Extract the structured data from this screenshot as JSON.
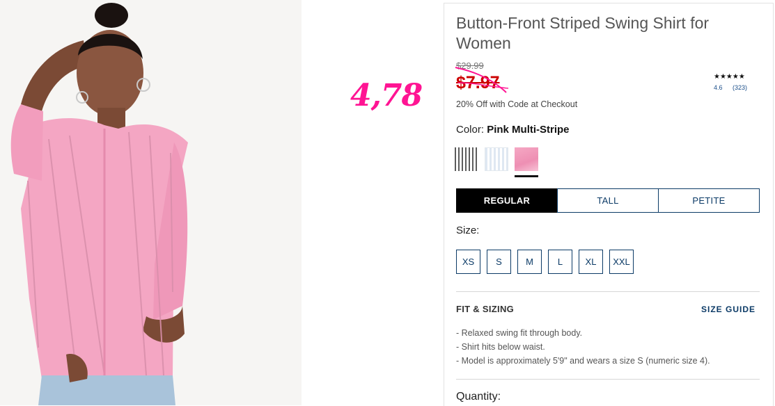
{
  "annotation": {
    "text": "4,78"
  },
  "product": {
    "title": "Button-Front Striped Swing Shirt for Women",
    "original_price": "$29.99",
    "sale_price": "$7.97",
    "promo": "20% Off with Code at Checkout",
    "rating": {
      "stars": "★★★★★",
      "value": "4.6",
      "count": "(323)"
    },
    "color_label": "Color:",
    "color_value": "Pink Multi-Stripe",
    "swatches": [
      "black-white-stripe",
      "blue-white-stripe",
      "pink-multi-stripe"
    ],
    "fit_tabs": [
      {
        "label": "REGULAR",
        "active": true
      },
      {
        "label": "TALL",
        "active": false
      },
      {
        "label": "PETITE",
        "active": false
      }
    ],
    "size_label": "Size:",
    "sizes": [
      "XS",
      "S",
      "M",
      "L",
      "XL",
      "XXL"
    ],
    "fit_sizing_heading": "FIT & SIZING",
    "size_guide_label": "SIZE GUIDE",
    "fit_notes": [
      "Relaxed swing fit through body.",
      "Shirt hits below waist.",
      "Model is approximately 5'9\" and wears a size S (numeric size 4)."
    ],
    "quantity_label": "Quantity:"
  },
  "colors": {
    "accent": "#0b3a66",
    "sale": "#cc0000",
    "annotation": "#ff1493",
    "shirt": "#f4a6c3"
  }
}
